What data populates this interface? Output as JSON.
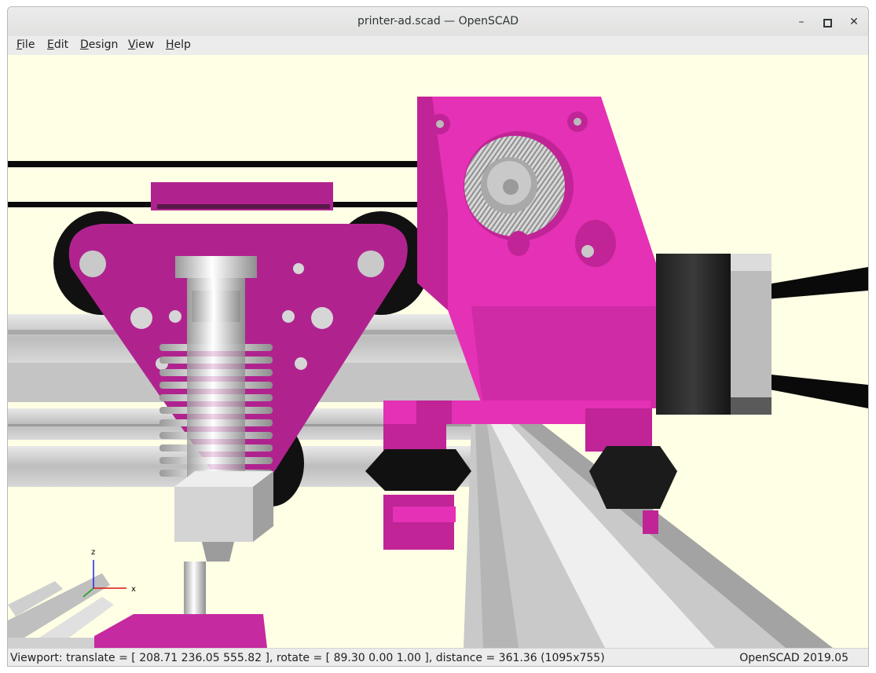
{
  "window": {
    "title": "printer-ad.scad — OpenSCAD"
  },
  "controls": {
    "minimize_glyph": "–",
    "maximize_glyph": "▫",
    "close_glyph": "✕"
  },
  "menu": [
    {
      "first": "F",
      "rest": "ile"
    },
    {
      "first": "E",
      "rest": "dit"
    },
    {
      "first": "D",
      "rest": "esign"
    },
    {
      "first": "V",
      "rest": "iew"
    },
    {
      "first": "H",
      "rest": "elp"
    }
  ],
  "axes": {
    "z_label": "z",
    "x_label": "x"
  },
  "status": {
    "viewport_text": "Viewport: translate = [ 208.71 236.05 555.82 ], rotate = [ 89.30 0.00 1.00 ], distance = 361.36 (1095x755)",
    "version": "OpenSCAD 2019.05"
  },
  "colors": {
    "background": "#ffffe5",
    "magenta_dark": "#b0238f",
    "magenta_bright": "#e431b6",
    "aluminium": "#cfcfcf",
    "belt": "#0a0a0a"
  },
  "icons": [
    "minimize-icon",
    "maximize-icon",
    "close-icon",
    "axis-gizmo-icon"
  ]
}
